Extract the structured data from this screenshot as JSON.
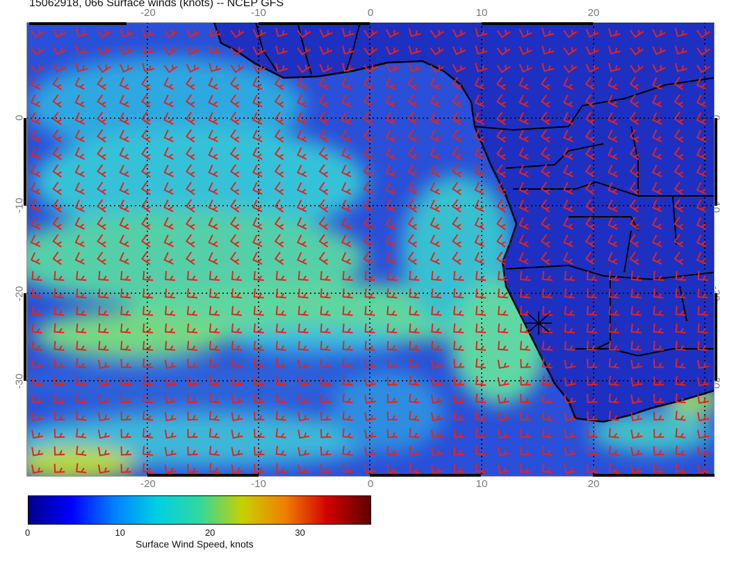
{
  "header": {
    "title": "15062918, 066 Surface winds (knots) -- NCEP GFS"
  },
  "map": {
    "lon_range": [
      -30,
      31
    ],
    "lat_range": [
      -40,
      8.5
    ],
    "x_ticks": [
      "-20",
      "-10",
      "0",
      "10",
      "20"
    ],
    "x_tick_values": [
      -20,
      -10,
      0,
      10,
      20
    ],
    "y_ticks": [
      "0",
      "-10",
      "-20",
      "-30"
    ],
    "y_tick_values": [
      0,
      -10,
      -20,
      -30
    ],
    "barb_color": "#e8221a",
    "land_color": "#1f33c4",
    "ocean_low_color": "#2a4fd8",
    "ocean_mid_color": "#2fc6d8",
    "ocean_high_color": "#7fd85a",
    "coastline_color": "#000000",
    "grid": true,
    "marker": "asterisk-marker"
  },
  "colorbar": {
    "min": 0,
    "max": 38,
    "labels": [
      "0",
      "10",
      "20",
      "30"
    ],
    "label_values": [
      0,
      10,
      20,
      30
    ],
    "title": "Surface Wind Speed, knots",
    "colors": [
      "#00008f",
      "#0000ff",
      "#0080ff",
      "#00d0e0",
      "#30d8a0",
      "#c8d000",
      "#f08000",
      "#d00000",
      "#600000"
    ]
  }
}
